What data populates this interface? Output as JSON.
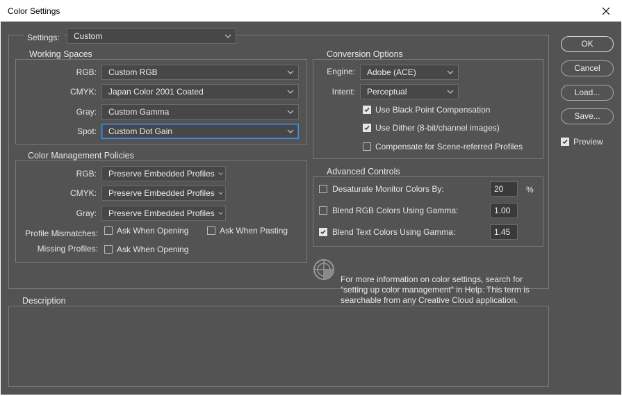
{
  "window": {
    "title": "Color Settings"
  },
  "settings": {
    "label": "Settings:",
    "value": "Custom"
  },
  "working_spaces": {
    "title": "Working Spaces",
    "rgb": {
      "label": "RGB:",
      "value": "Custom RGB"
    },
    "cmyk": {
      "label": "CMYK:",
      "value": "Japan Color 2001 Coated"
    },
    "gray": {
      "label": "Gray:",
      "value": "Custom Gamma"
    },
    "spot": {
      "label": "Spot:",
      "value": "Custom Dot Gain"
    }
  },
  "policies": {
    "title": "Color Management Policies",
    "rgb": {
      "label": "RGB:",
      "value": "Preserve Embedded Profiles"
    },
    "cmyk": {
      "label": "CMYK:",
      "value": "Preserve Embedded Profiles"
    },
    "gray": {
      "label": "Gray:",
      "value": "Preserve Embedded Profiles"
    },
    "profile_mismatches": {
      "label": "Profile Mismatches:",
      "ask_opening": "Ask When Opening",
      "ask_pasting": "Ask When Pasting"
    },
    "missing_profiles": {
      "label": "Missing Profiles:",
      "ask_opening": "Ask When Opening"
    }
  },
  "conversion": {
    "title": "Conversion Options",
    "engine": {
      "label": "Engine:",
      "value": "Adobe (ACE)"
    },
    "intent": {
      "label": "Intent:",
      "value": "Perceptual"
    },
    "black_point": "Use Black Point Compensation",
    "dither": "Use Dither (8-bit/channel images)",
    "scene_referred": "Compensate for Scene-referred Profiles"
  },
  "advanced": {
    "title": "Advanced Controls",
    "desaturate": {
      "label": "Desaturate Monitor Colors By:",
      "value": "20",
      "unit": "%"
    },
    "blend_rgb": {
      "label": "Blend RGB Colors Using Gamma:",
      "value": "1.00"
    },
    "blend_text": {
      "label": "Blend Text Colors Using Gamma:",
      "value": "1.45"
    }
  },
  "info_text": "For more information on color settings, search for “setting up color management” in Help. This term is searchable from any Creative Cloud application.",
  "description": {
    "title": "Description"
  },
  "buttons": {
    "ok": "OK",
    "cancel": "Cancel",
    "load": "Load...",
    "save": "Save...",
    "preview": "Preview"
  },
  "colors": {
    "dialog_bg": "#535353",
    "focus": "#4a8fe0"
  }
}
